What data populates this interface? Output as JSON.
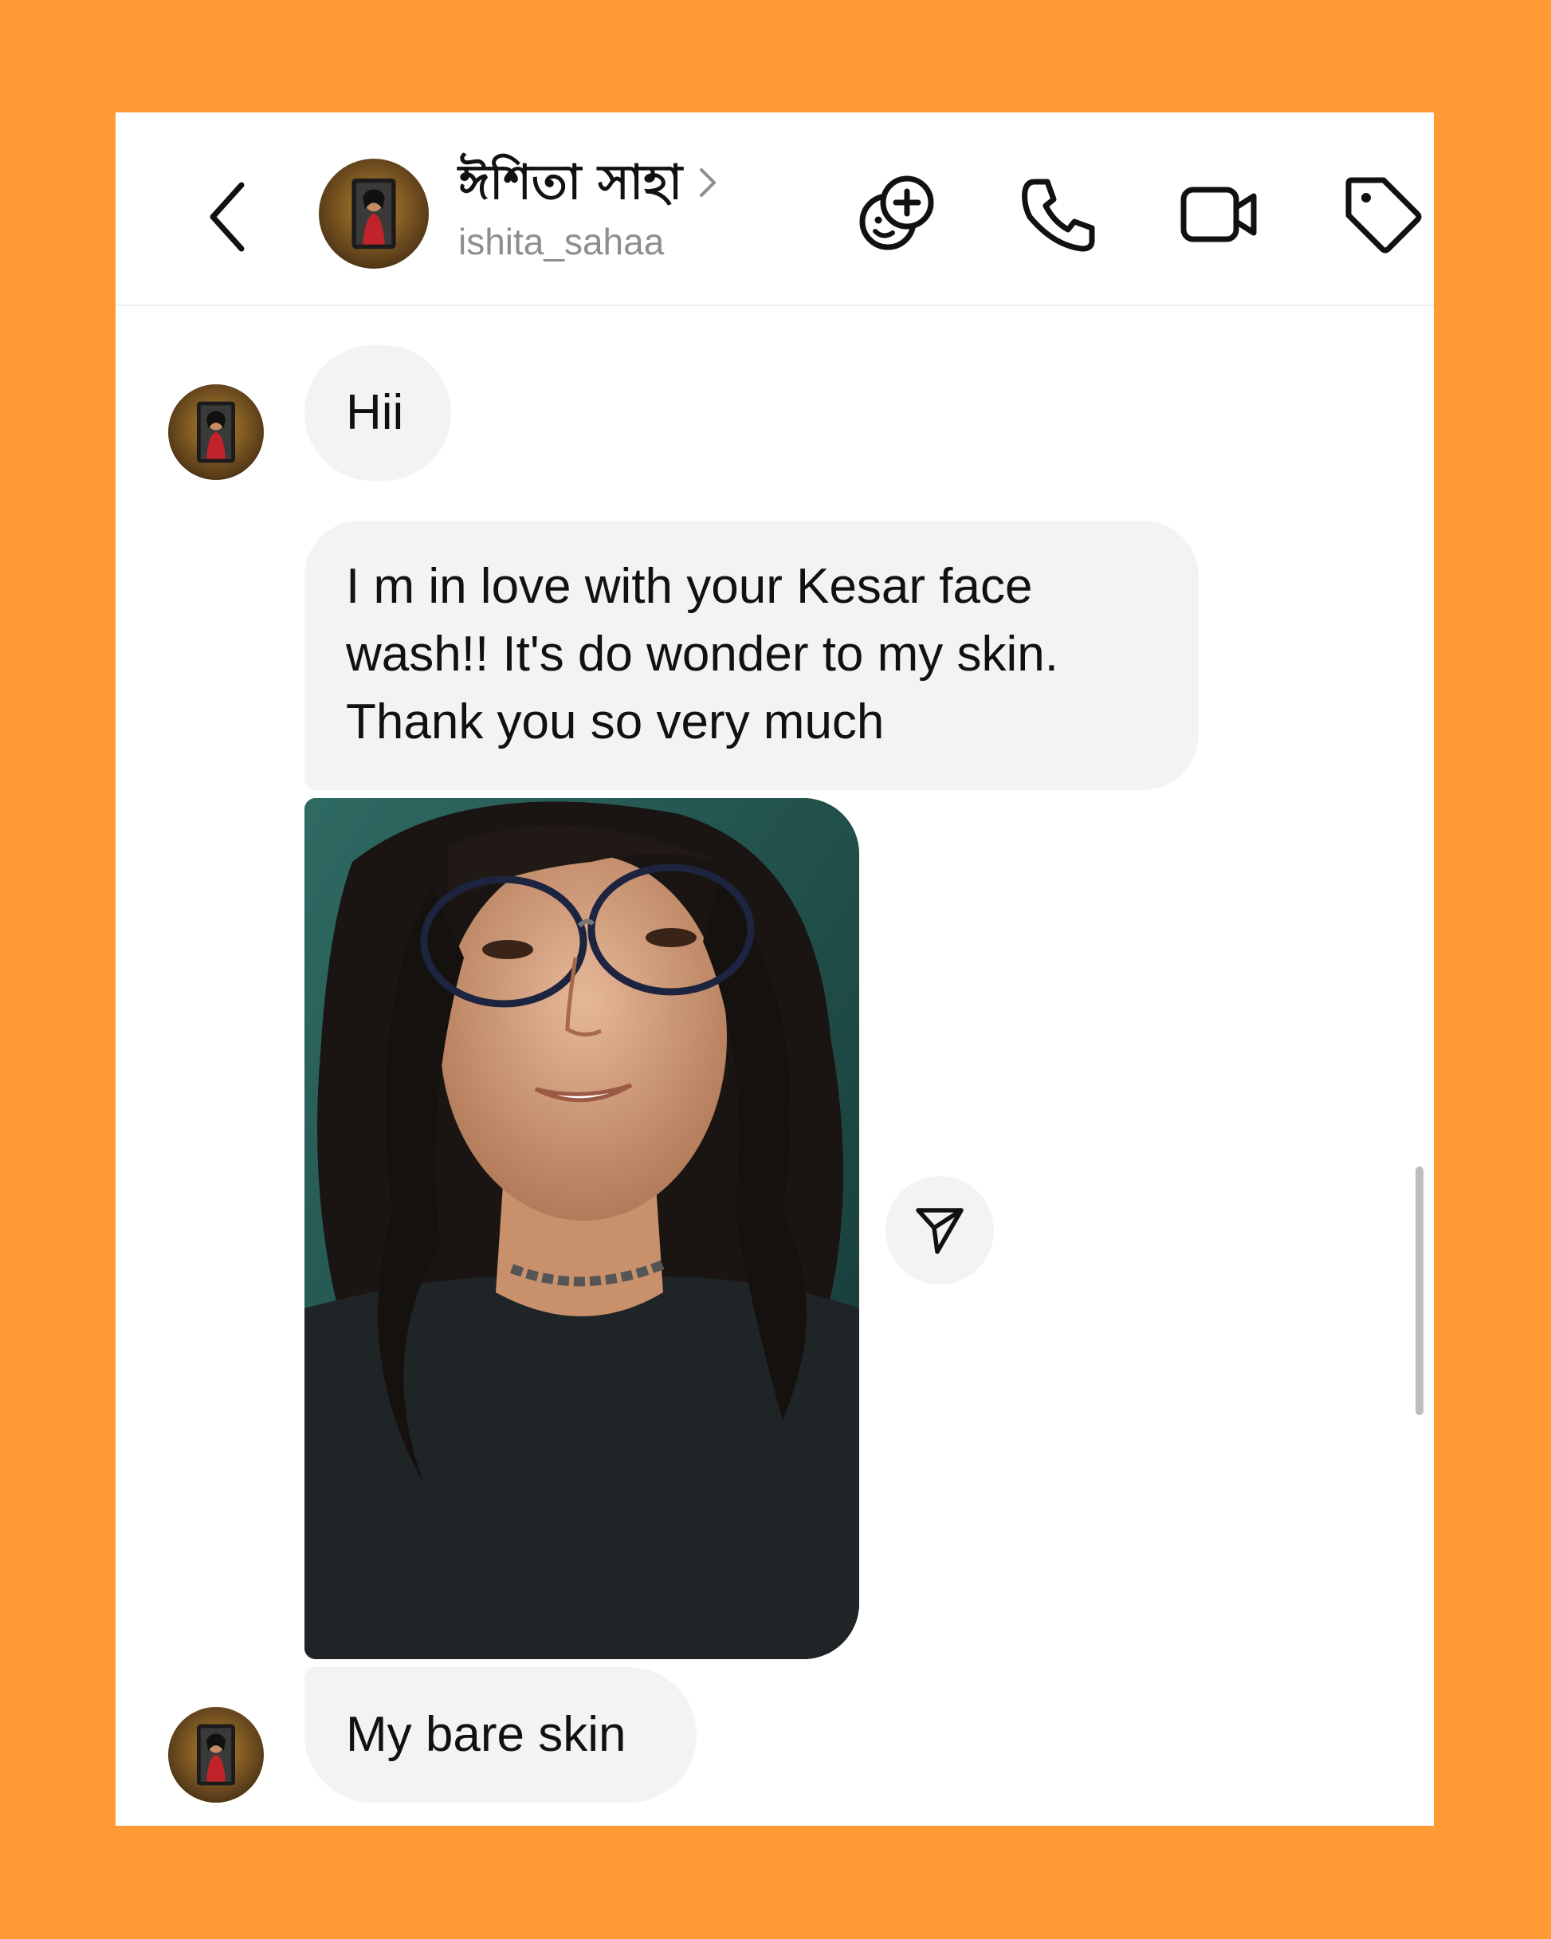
{
  "header": {
    "display_name": "ঈশিতা সাহা",
    "username": "ishita_sahaa",
    "icons": [
      "back-arrow-icon",
      "chevron-right-icon",
      "add-sticker-icon",
      "phone-icon",
      "video-icon",
      "tag-icon"
    ]
  },
  "messages": [
    {
      "type": "text",
      "text": "Hii"
    },
    {
      "type": "text",
      "lines": [
        "I m in love with your Kesar face",
        "wash!! It's do wonder to my skin.",
        "Thank you so very much"
      ]
    },
    {
      "type": "image"
    },
    {
      "type": "text",
      "text": "My bare skin"
    }
  ],
  "colors": {
    "frame_background": "#FF9933",
    "bubble": "#F2F3F5",
    "text": "#111111",
    "username": "#8E8E8E"
  }
}
